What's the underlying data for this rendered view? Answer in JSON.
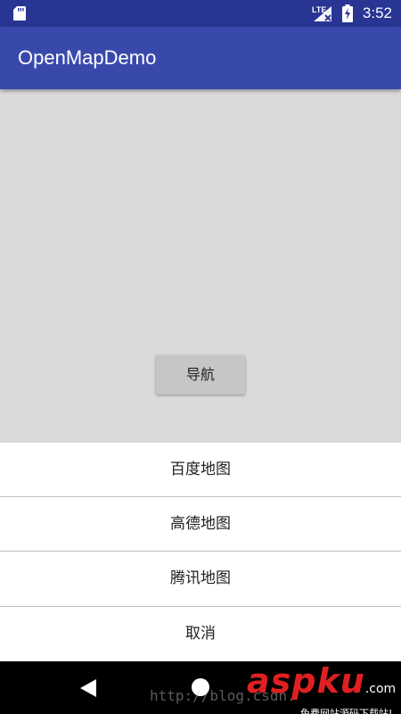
{
  "status_bar": {
    "time": "3:52",
    "network_label": "LTE",
    "icons": [
      "sd-card-icon",
      "lte-signal-icon",
      "battery-charging-icon"
    ]
  },
  "app_bar": {
    "title": "OpenMapDemo"
  },
  "main": {
    "nav_button_label": "导航"
  },
  "sheet": {
    "items": [
      {
        "label": "百度地图"
      },
      {
        "label": "高德地图"
      },
      {
        "label": "腾讯地图"
      },
      {
        "label": "取消"
      }
    ]
  },
  "nav_bar": {
    "icons": [
      "back-icon",
      "home-icon"
    ]
  },
  "watermark": {
    "url": "http://blog.csdn.",
    "brand_a": "asp",
    "brand_b": "ku",
    "brand_tld": ".com",
    "slogan": "免费网站源码下载站!"
  },
  "colors": {
    "status_bar": "#283593",
    "app_bar": "#3949ab",
    "content_bg": "#dadada",
    "button_bg": "#c6c6c6",
    "sheet_bg": "#ffffff",
    "divider": "#bdbdbd",
    "nav_bar": "#000000",
    "watermark_red": "#e02020"
  }
}
